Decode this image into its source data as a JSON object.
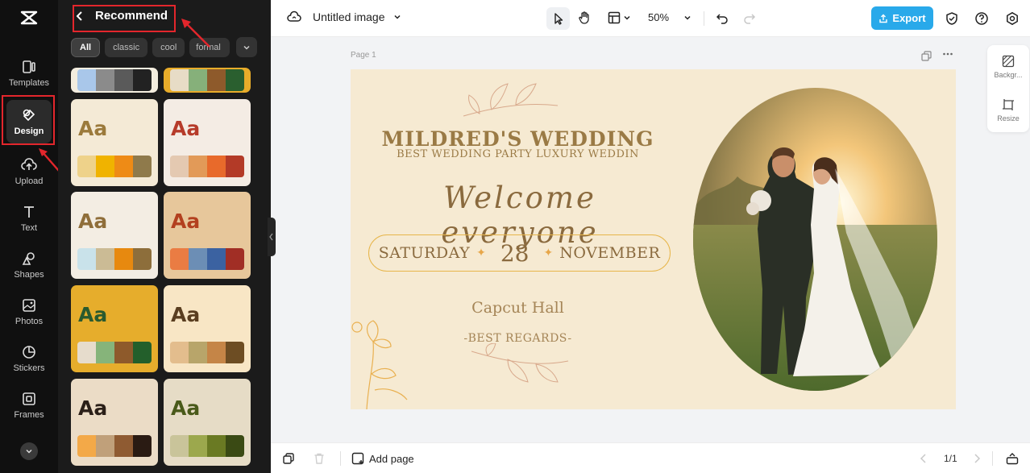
{
  "app": {
    "document_title": "Untitled image"
  },
  "rail": {
    "items": [
      {
        "label": "Templates",
        "icon": "templates-icon"
      },
      {
        "label": "Design",
        "icon": "design-icon"
      },
      {
        "label": "Upload",
        "icon": "upload-icon"
      },
      {
        "label": "Text",
        "icon": "text-icon"
      },
      {
        "label": "Shapes",
        "icon": "shapes-icon"
      },
      {
        "label": "Photos",
        "icon": "photos-icon"
      },
      {
        "label": "Stickers",
        "icon": "stickers-icon"
      },
      {
        "label": "Frames",
        "icon": "frames-icon"
      }
    ],
    "active": "Design"
  },
  "panel": {
    "title": "Recommend",
    "chips": [
      "All",
      "classic",
      "cool",
      "formal"
    ],
    "active_chip": "All",
    "cards": [
      {
        "aa": "",
        "aa_color": "",
        "bg": "#f3eddf",
        "swatches": [
          "#a9c7ea",
          "#8b8b8b",
          "#5a5a5a",
          "#222222"
        ],
        "partial": true
      },
      {
        "aa": "",
        "aa_color": "",
        "bg": "#e8ac2a",
        "swatches": [
          "#e7dcc6",
          "#86b07a",
          "#8e5a2b",
          "#2a5f2f"
        ],
        "partial": true
      },
      {
        "aa": "Aa",
        "aa_color": "#9b7a3c",
        "bg": "#f4ead6",
        "swatches": [
          "#eed28a",
          "#f0b300",
          "#ee8b16",
          "#8f7a4b"
        ]
      },
      {
        "aa": "Aa",
        "aa_color": "#b63b2a",
        "bg": "#f4ece4",
        "swatches": [
          "#e4c9b1",
          "#e29a58",
          "#e86a2b",
          "#b33a27"
        ]
      },
      {
        "aa": "Aa",
        "aa_color": "#8f6e3a",
        "bg": "#f3ede3",
        "swatches": [
          "#c9e2ea",
          "#cbbb95",
          "#e7890f",
          "#8d6e3b"
        ]
      },
      {
        "aa": "Aa",
        "aa_color": "#b3401f",
        "bg": "#e7c79b",
        "swatches": [
          "#ea7c43",
          "#6c8eb5",
          "#3b62a1",
          "#a12e25"
        ]
      },
      {
        "aa": "Aa",
        "aa_color": "#2a5a2e",
        "bg": "#e6ad2c",
        "swatches": [
          "#e6dccc",
          "#86b47a",
          "#8e5a2b",
          "#235f2b"
        ]
      },
      {
        "aa": "Aa",
        "aa_color": "#5a3e20",
        "bg": "#f8e6c5",
        "swatches": [
          "#e3bd8d",
          "#b8a56a",
          "#c58547",
          "#6d4d23"
        ]
      },
      {
        "aa": "Aa",
        "aa_color": "#2a1f18",
        "bg": "#ebdcc6",
        "swatches": [
          "#f3a948",
          "#c0a07a",
          "#8f5b32",
          "#2a1b13"
        ]
      },
      {
        "aa": "Aa",
        "aa_color": "#4a5a1a",
        "bg": "#e6dcc6",
        "swatches": [
          "#c9c49a",
          "#9ca84d",
          "#6a7a23",
          "#3a4a14"
        ]
      }
    ]
  },
  "toolbar": {
    "zoom": "50%",
    "export_label": "Export"
  },
  "canvas": {
    "page_label": "Page 1",
    "title": "MILDRED'S WEDDING",
    "subtitle": "BEST WEDDING PARTY LUXURY WEDDIN",
    "welcome": "Welcome everyone",
    "day": "SATURDAY",
    "date": "28",
    "month": "NOVEMBER",
    "venue": "Capcut Hall",
    "regards": "-BEST REGARDS-"
  },
  "right_panel": {
    "background_label": "Backgr...",
    "resize_label": "Resize"
  },
  "bottom": {
    "add_page_label": "Add page",
    "pager": "1/1"
  }
}
